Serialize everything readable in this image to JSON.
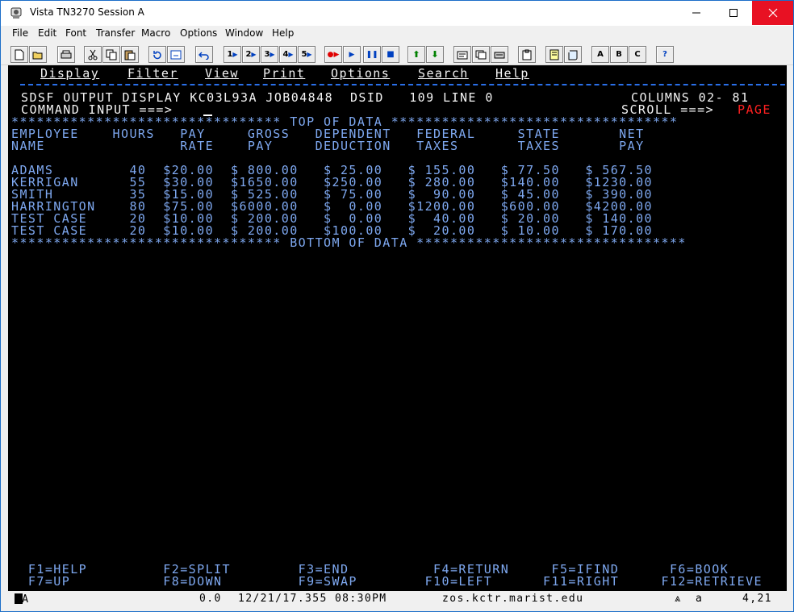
{
  "window": {
    "title": "Vista TN3270 Session A"
  },
  "menubar": {
    "items": [
      "File",
      "Edit",
      "Font",
      "Transfer",
      "Macro",
      "Options",
      "Window",
      "Help"
    ]
  },
  "toolbar": {
    "macro_labels": [
      "1",
      "2",
      "3",
      "4",
      "5"
    ],
    "letter_labels": [
      "A",
      "B",
      "C"
    ],
    "help_label": "?"
  },
  "terminal": {
    "action_bar": [
      "Display",
      "Filter",
      "View",
      "Print",
      "Options",
      "Search",
      "Help"
    ],
    "header_line": "SDSF OUTPUT DISPLAY KC03L93A JOB04848  DSID   109 LINE 0",
    "columns_text": "COLUMNS 02- 81",
    "command_label": "COMMAND INPUT ===>",
    "scroll_label": "SCROLL ===>",
    "scroll_value": "PAGE",
    "top_of_data": "******************************** TOP OF DATA **********************************",
    "bottom_of_data": "******************************** BOTTOM OF DATA ********************************",
    "header_row1": "EMPLOYEE    HOURS   PAY     GROSS   DEPENDENT   FEDERAL     STATE       NET",
    "header_row2": "NAME                RATE    PAY     DEDUCTION   TAXES       TAXES       PAY",
    "rows": [
      "ADAMS         40  $20.00  $ 800.00   $ 25.00   $ 155.00   $ 77.50   $ 567.50",
      "KERRIGAN      55  $30.00  $1650.00   $250.00   $ 280.00   $140.00   $1230.00",
      "SMITH         35  $15.00  $ 525.00   $ 75.00   $  90.00   $ 45.00   $ 390.00",
      "HARRINGTON    80  $75.00  $6000.00   $  0.00   $1200.00   $600.00   $4200.00",
      "TEST CASE     20  $10.00  $ 200.00   $  0.00   $  40.00   $ 20.00   $ 140.00",
      "TEST CASE     20  $10.00  $ 200.00   $100.00   $  20.00   $ 10.00   $ 170.00"
    ],
    "pf_row1": "  F1=HELP         F2=SPLIT        F3=END          F4=RETURN     F5=IFIND      F6=BOOK",
    "pf_row2": "  F7=UP           F8=DOWN         F9=SWAP        F10=LEFT      F11=RIGHT     F12=RETRIEVE"
  },
  "status": {
    "indicator": "MA",
    "elapsed": "0.0",
    "datetime": "12/21/17.355 08:30PM",
    "host": "zos.kctr.marist.edu",
    "mode": "a",
    "position": "4,21"
  }
}
